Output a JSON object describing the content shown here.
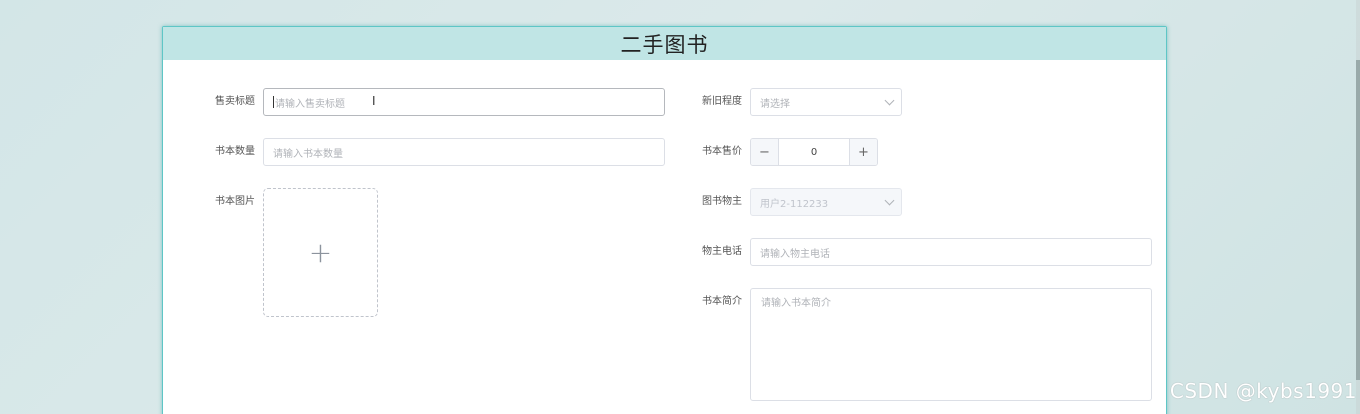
{
  "header": {
    "title": "二手图书"
  },
  "form": {
    "sale_title": {
      "label": "售卖标题",
      "placeholder": "请输入售卖标题",
      "value": ""
    },
    "condition": {
      "label": "新旧程度",
      "placeholder": "请选择"
    },
    "quantity": {
      "label": "书本数量",
      "placeholder": "请输入书本数量",
      "value": ""
    },
    "price": {
      "label": "书本售价",
      "value": "0",
      "minus": "−",
      "plus": "+"
    },
    "image": {
      "label": "书本图片",
      "plus": "+"
    },
    "owner": {
      "label": "图书物主",
      "value": "用户2-112233"
    },
    "phone": {
      "label": "物主电话",
      "placeholder": "请输入物主电话",
      "value": ""
    },
    "intro": {
      "label": "书本简介",
      "placeholder": "请输入书本简介"
    }
  },
  "watermark": "CSDN @kybs1991",
  "colors": {
    "header_bg": "#c0e5e5",
    "card_border": "#5ec6c6",
    "page_bg": "#d3e6e7"
  }
}
